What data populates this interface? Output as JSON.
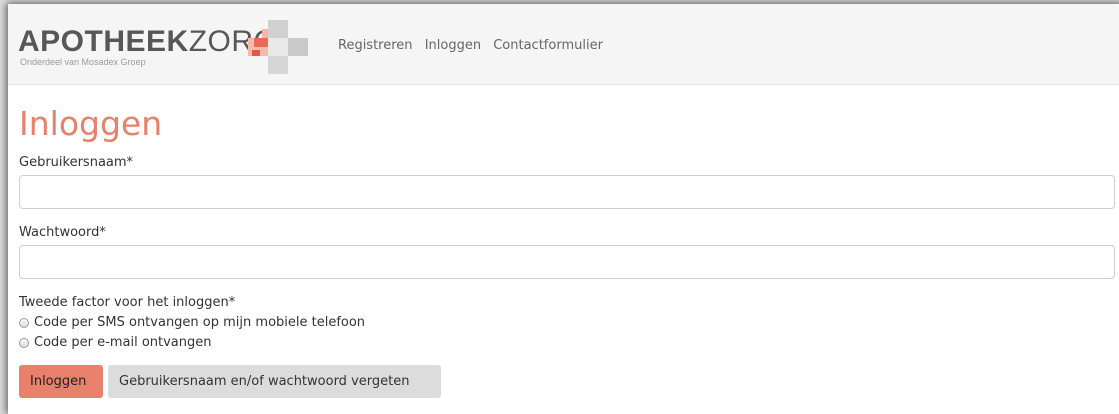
{
  "brand": {
    "logo_bold": "APOTHEEK",
    "logo_light": "ZORG",
    "logo_subtitle": "Onderdeel van Mosadex Groep"
  },
  "nav": {
    "links": [
      "Registreren",
      "Inloggen",
      "Contactformulier"
    ]
  },
  "page": {
    "title": "Inloggen"
  },
  "form": {
    "username_label": "Gebruikersnaam*",
    "username_value": "",
    "password_label": "Wachtwoord*",
    "password_value": "",
    "second_factor_label": "Tweede factor voor het inloggen*",
    "second_factor_options": [
      "Code per SMS ontvangen op mijn mobiele telefoon",
      "Code per e-mail ontvangen"
    ],
    "submit_label": "Inloggen",
    "forgot_label": "Gebruikersnaam en/of wachtwoord vergeten"
  },
  "colors": {
    "accent": "#e8806b",
    "secondary_button": "#dcdcdc",
    "cross_dark": "#e05a45",
    "cross_light": "#f4b6a8",
    "cross_grey": "#cfcfcf"
  },
  "icons": [
    "logo-cross-icon",
    "radio-icon"
  ]
}
